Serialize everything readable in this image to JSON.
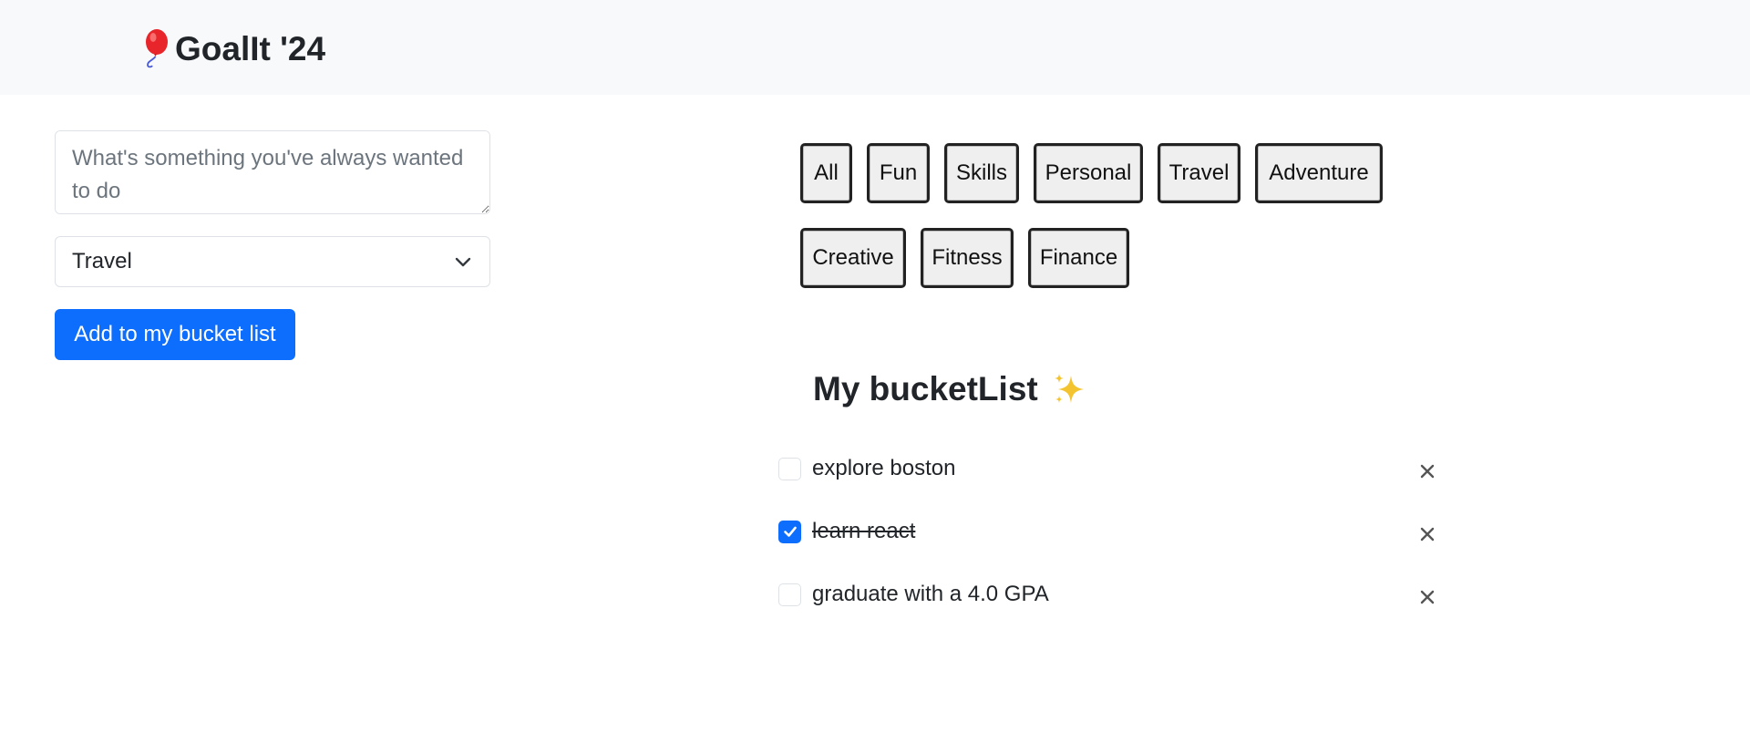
{
  "app": {
    "title": "GoalIt '24",
    "logo_icon": "balloon-icon"
  },
  "form": {
    "goal_placeholder": "What's something you've always wanted to do",
    "goal_value": "",
    "category_selected": "Travel",
    "category_icon": "chevron-down-icon",
    "add_button_label": "Add to my bucket list"
  },
  "filters": [
    {
      "label": "All"
    },
    {
      "label": "Fun"
    },
    {
      "label": "Skills"
    },
    {
      "label": "Personal"
    },
    {
      "label": "Travel"
    },
    {
      "label": "Adventure"
    },
    {
      "label": "Creative"
    },
    {
      "label": "Fitness"
    },
    {
      "label": "Finance"
    }
  ],
  "bucket_list": {
    "title": "My bucketList",
    "title_icon": "sparkles-icon",
    "items": [
      {
        "text": "explore boston",
        "done": false
      },
      {
        "text": "learn react",
        "done": true
      },
      {
        "text": "graduate with a 4.0 GPA",
        "done": false
      }
    ],
    "delete_icon": "close-icon"
  },
  "colors": {
    "primary": "#0d6efd",
    "navbar_bg": "#f8f9fa",
    "text": "#212529",
    "filter_bg": "#efefef"
  }
}
